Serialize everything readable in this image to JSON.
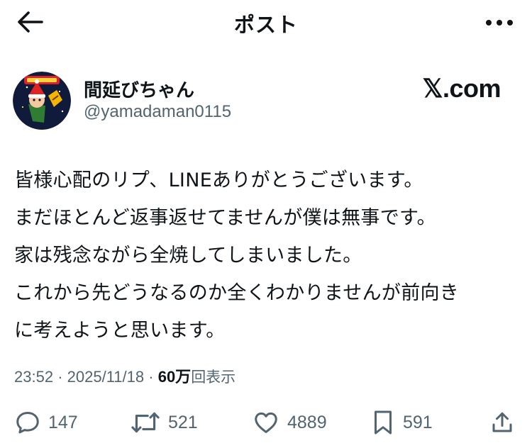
{
  "header": {
    "title": "ポスト",
    "back_icon": "arrow-left-icon",
    "more_icon": "more-horizontal-icon"
  },
  "author": {
    "display_name": "間延びちゃん",
    "handle": "@yamadaman0115",
    "avatar_icon": "profile-avatar"
  },
  "source": {
    "label": "𝕏.com"
  },
  "post": {
    "lines": [
      "皆様心配のリプ、LINEありがとうございます。",
      "まだほとんど返事返せてませんが僕は無事です。",
      "家は残念ながら全焼してしまいました。",
      "これから先どうなるのか全くわかりませんが前向き",
      "に考えようと思います。"
    ]
  },
  "meta": {
    "time": "23:52",
    "date": "2025/11/18",
    "separator": "·",
    "views_count": "60万",
    "views_label": "回表示"
  },
  "actions": {
    "replies": "147",
    "reposts": "521",
    "likes": "4889",
    "bookmarks": "591"
  },
  "colors": {
    "text": "#0f1419",
    "secondary": "#536471",
    "background": "#ffffff"
  }
}
